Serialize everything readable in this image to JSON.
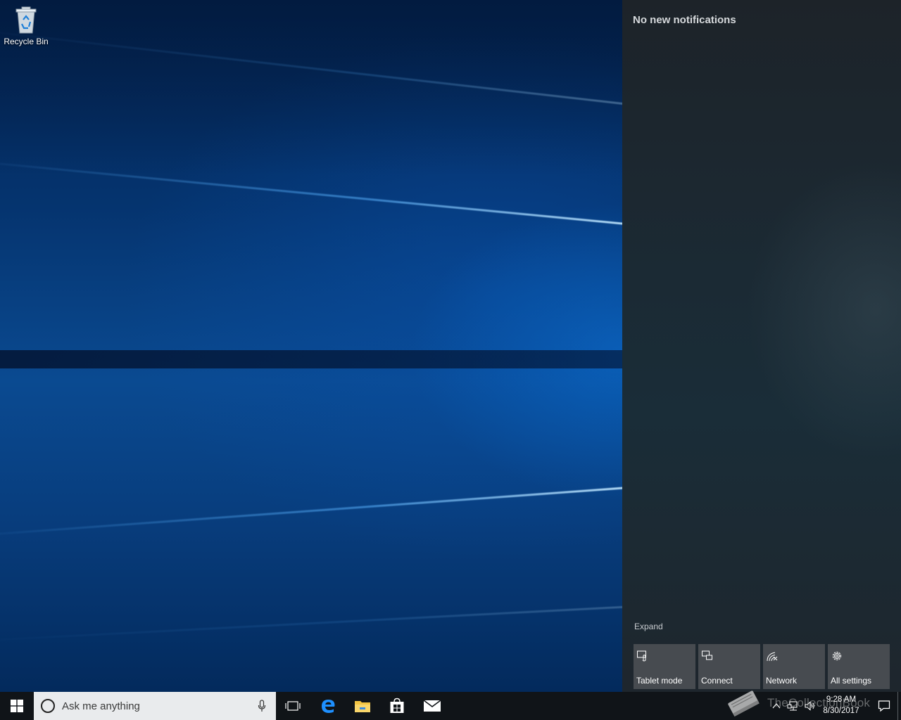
{
  "desktop": {
    "icons": [
      {
        "label": "Recycle Bin",
        "icon": "recycle-bin-icon"
      }
    ]
  },
  "action_center": {
    "title": "No new notifications",
    "expand_label": "Expand",
    "quick_actions": [
      {
        "label": "Tablet mode",
        "icon": "tablet-mode-icon"
      },
      {
        "label": "Connect",
        "icon": "connect-icon"
      },
      {
        "label": "Network",
        "icon": "network-icon"
      },
      {
        "label": "All settings",
        "icon": "gear-icon"
      }
    ]
  },
  "taskbar": {
    "search_placeholder": "Ask me anything",
    "pinned": [
      {
        "name": "Task View",
        "icon": "task-view-icon"
      },
      {
        "name": "Microsoft Edge",
        "icon": "edge-icon"
      },
      {
        "name": "File Explorer",
        "icon": "file-explorer-icon"
      },
      {
        "name": "Store",
        "icon": "store-icon"
      },
      {
        "name": "Mail",
        "icon": "mail-icon"
      }
    ],
    "clock": {
      "time": "9:28 AM",
      "date": "8/30/2017"
    }
  },
  "watermark": {
    "text": "TheCollectionBook"
  },
  "colors": {
    "accent": "#0078d7",
    "taskbar": "#101418",
    "tile": "#474b50"
  }
}
